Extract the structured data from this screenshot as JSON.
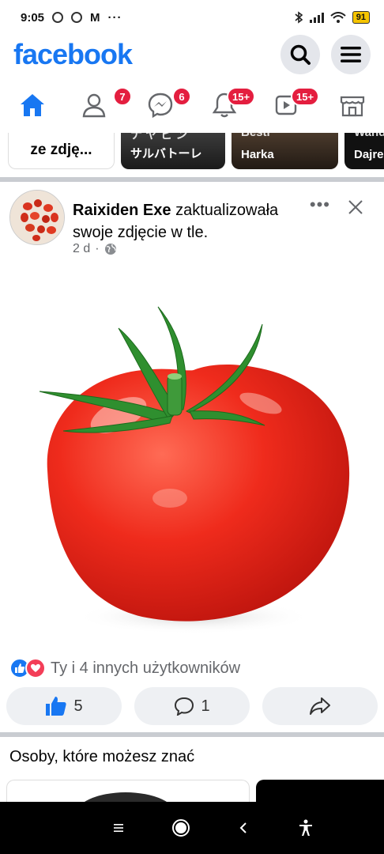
{
  "status_bar": {
    "time": "9:05",
    "notif_m": "M",
    "more_dots": "···",
    "battery": "91"
  },
  "header": {
    "logo": "facebook"
  },
  "nav": {
    "friends_badge": "7",
    "messenger_badge": "6",
    "notifications_badge": "15+",
    "watch_badge": "15+"
  },
  "stories": {
    "create_label": "ze zdję...",
    "story2_top": "ナ ヤ ビ  ン",
    "story2_name": "サルバトーレ",
    "story3_top": "Besti",
    "story3_name": "Harka",
    "story4_top": "Wand",
    "story4_name": "Dajre"
  },
  "post": {
    "author": "Raixiden Exe",
    "action_text": " zaktualizowała swoje zdjęcie w tle.",
    "time": "2 d",
    "dot": "·",
    "more": "•••",
    "reactions_text": "Ty i 4 innych użytkowników",
    "like_count": "5",
    "comment_count": "1"
  },
  "pymk": {
    "title": "Osoby, które możesz znać"
  },
  "colors": {
    "brand": "#1877f2",
    "badge": "#e41e3f",
    "love": "#f33e58"
  }
}
